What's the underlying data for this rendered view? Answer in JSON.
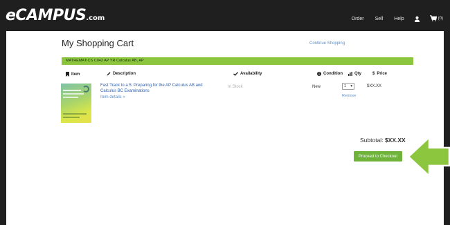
{
  "header": {
    "logo_main": "eCAMPUS",
    "logo_suffix": ".com",
    "nav": {
      "order": "Order",
      "sell": "Sell",
      "help": "Help",
      "cart_count": "(0)"
    },
    "icons": {
      "user": "user-icon",
      "cart": "cart-icon"
    }
  },
  "page": {
    "title": "My Shopping Cart",
    "continue_link": "Continue Shopping"
  },
  "course_bar": "MATHEMATICS  C042  AP  YR  Calculus AB, AP",
  "columns": {
    "item": "Item",
    "description": "Description",
    "availability": "Availability",
    "condition": "Condition",
    "qty": "Qty",
    "price": "Price"
  },
  "cart_item": {
    "title": "Fast Track to a 5: Preparing for the AP Calculus AB and Calculus BC Examinations",
    "details_link": "Item details »",
    "availability": "In Stock",
    "condition": "New",
    "qty": "1",
    "remove": "Remove",
    "price": "$XX.XX"
  },
  "summary": {
    "subtotal_label": "Subtotal:",
    "subtotal_value": "$XX.XX",
    "checkout_button": "Proceed to Checkout"
  },
  "colors": {
    "topbar": "#1f1f1f",
    "course_bar": "#8cc63f",
    "checkout": "#6fb33b",
    "arrow": "#8cc63f",
    "link": "#2a5db0"
  }
}
